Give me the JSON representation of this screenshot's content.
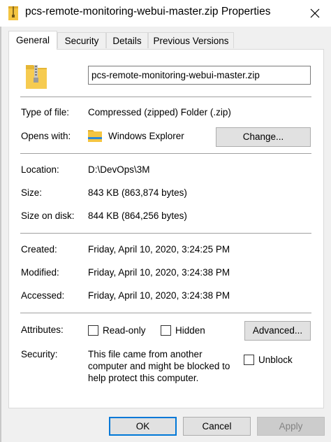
{
  "window": {
    "title": "pcs-remote-monitoring-webui-master.zip Properties",
    "icon": "zip-folder-icon",
    "close_icon": "close-icon"
  },
  "tabs": [
    {
      "label": "General",
      "active": true
    },
    {
      "label": "Security",
      "active": false
    },
    {
      "label": "Details",
      "active": false
    },
    {
      "label": "Previous Versions",
      "active": false
    }
  ],
  "general": {
    "file_name": "pcs-remote-monitoring-webui-master.zip",
    "type_label": "Type of file:",
    "type_value": "Compressed (zipped) Folder (.zip)",
    "opens_label": "Opens with:",
    "opens_value": "Windows Explorer",
    "change_button": "Change...",
    "location_label": "Location:",
    "location_value": "D:\\DevOps\\3M",
    "size_label": "Size:",
    "size_value": "843 KB (863,874 bytes)",
    "size_disk_label": "Size on disk:",
    "size_disk_value": "844 KB (864,256 bytes)",
    "created_label": "Created:",
    "created_value": "Friday, April 10, 2020, 3:24:25 PM",
    "modified_label": "Modified:",
    "modified_value": "Friday, April 10, 2020, 3:24:38 PM",
    "accessed_label": "Accessed:",
    "accessed_value": "Friday, April 10, 2020, 3:24:38 PM",
    "attributes_label": "Attributes:",
    "readonly_label": "Read-only",
    "hidden_label": "Hidden",
    "advanced_button": "Advanced...",
    "security_label": "Security:",
    "security_text_1": "This file came from another",
    "security_text_2": "computer and might be blocked to",
    "security_text_3": "help protect this computer.",
    "unblock_label": "Unblock"
  },
  "footer": {
    "ok": "OK",
    "cancel": "Cancel",
    "apply": "Apply"
  },
  "colors": {
    "accent": "#0078d7",
    "folder": "#f4c542"
  }
}
